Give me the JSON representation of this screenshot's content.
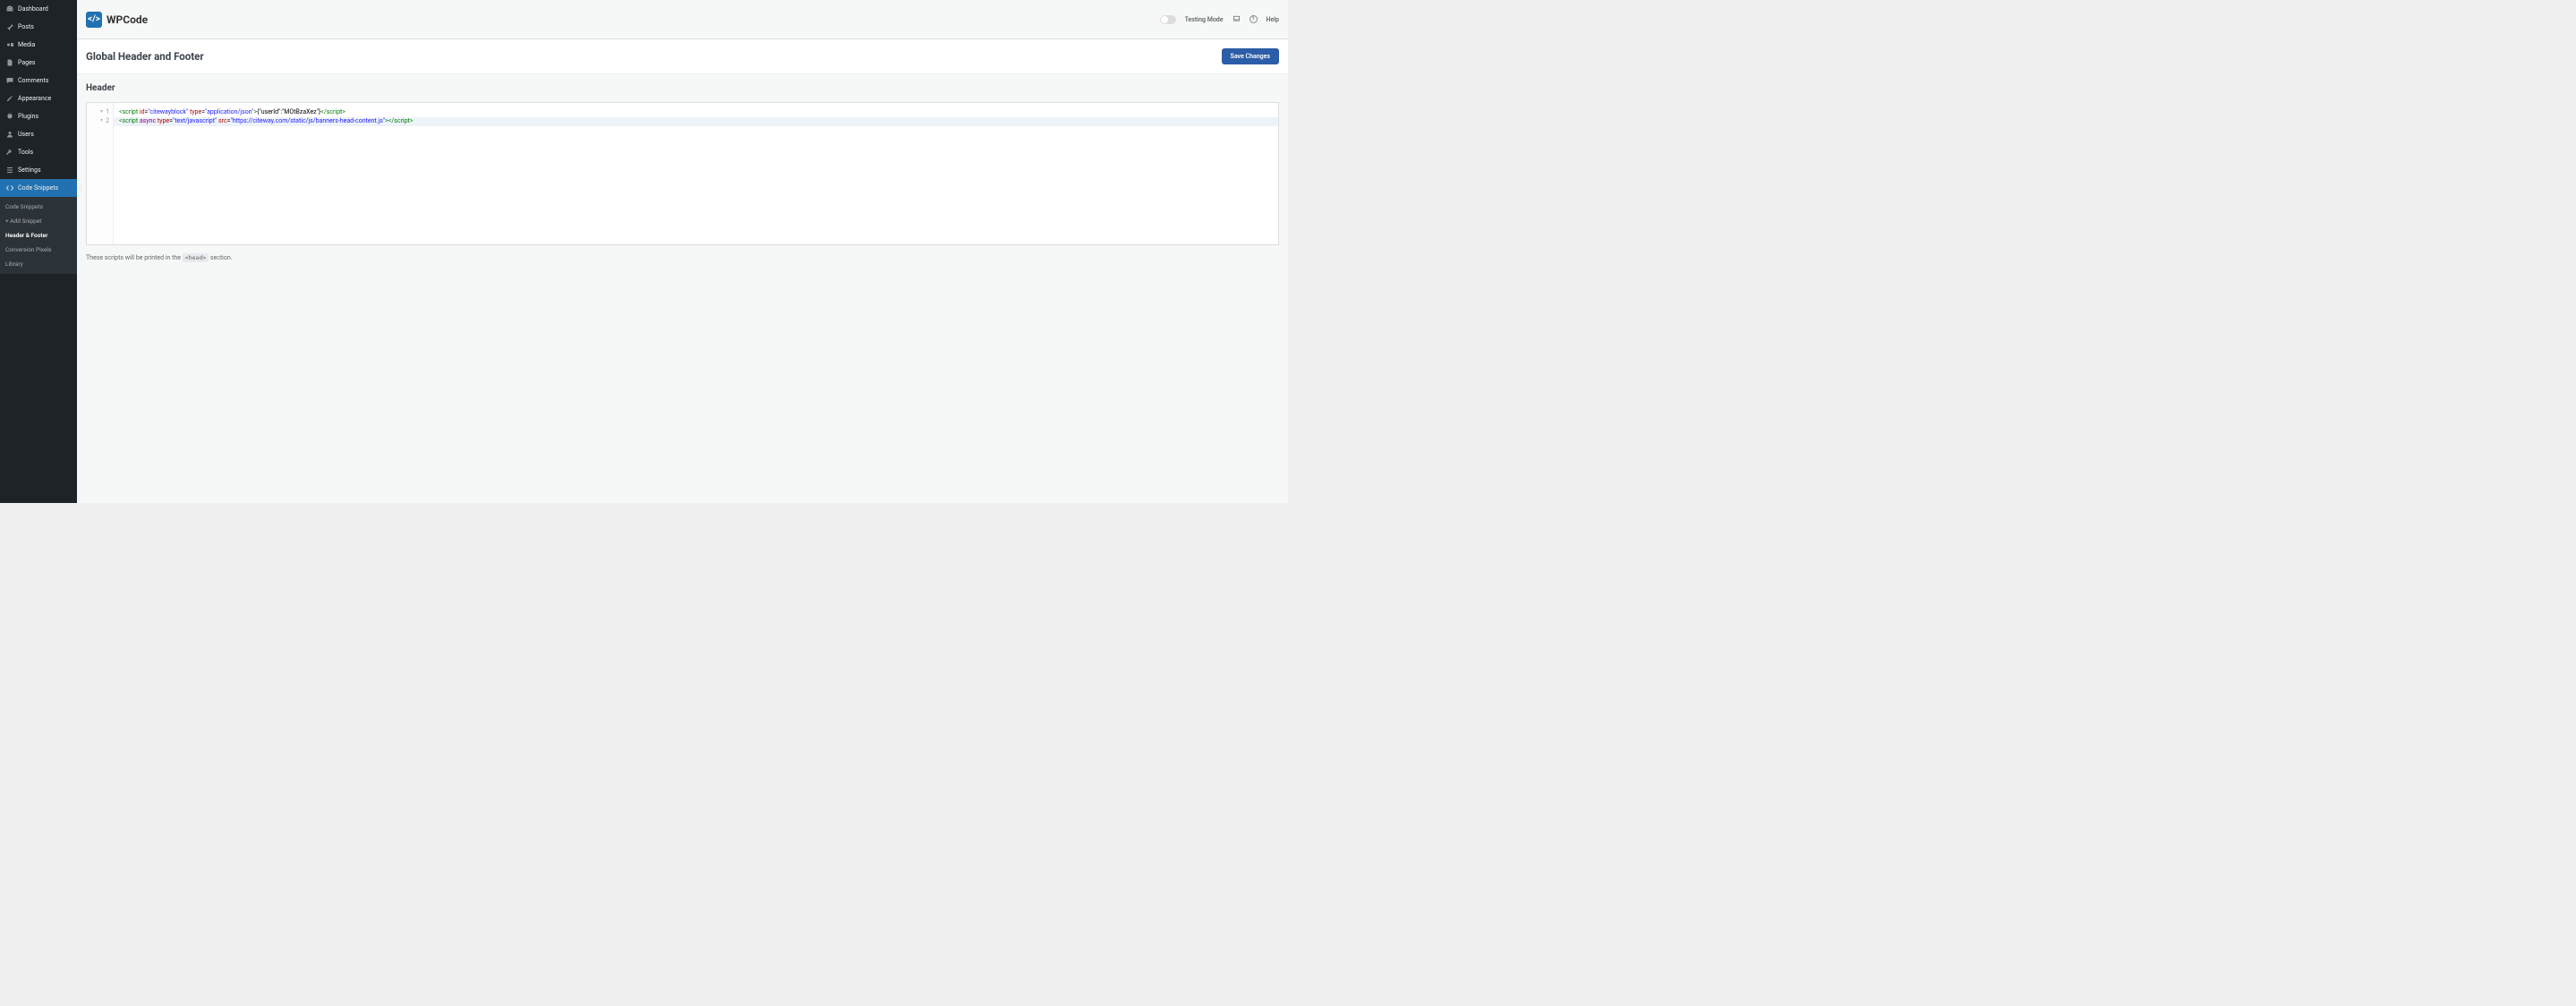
{
  "sidebar": {
    "items": [
      {
        "label": "Dashboard"
      },
      {
        "label": "Posts"
      },
      {
        "label": "Media"
      },
      {
        "label": "Pages"
      },
      {
        "label": "Comments"
      },
      {
        "label": "Appearance"
      },
      {
        "label": "Plugins"
      },
      {
        "label": "Users"
      },
      {
        "label": "Tools"
      },
      {
        "label": "Settings"
      },
      {
        "label": "Code Snippets"
      }
    ],
    "submenu": [
      {
        "label": "Code Snippets"
      },
      {
        "label": "+ Add Snippet"
      },
      {
        "label": "Header & Footer"
      },
      {
        "label": "Conversion Pixels"
      },
      {
        "label": "Library"
      }
    ]
  },
  "logo": {
    "mark": "</>",
    "text": "WPCode"
  },
  "topbar": {
    "testing_mode": "Testing Mode",
    "help": "Help"
  },
  "header": {
    "title": "Global Header and Footer",
    "save": "Save Changes"
  },
  "section": {
    "title": "Header"
  },
  "code": {
    "line1_parts": {
      "open": "<script ",
      "id_attr": "id",
      "id_val": "\"citewayblock\"",
      "type_attr": "type",
      "type_val": "\"application/json\"",
      "inner": "{\"userId\":\"MOtBzaXez\"}",
      "close_tag": "script"
    },
    "line2_parts": {
      "open": "<script ",
      "async_kw": "async",
      "type_attr": "type",
      "type_val": "\"text/javascript\"",
      "src_attr": "src",
      "src_val": "\"https://citeway.com/static/js/banners-head-content.js\"",
      "close_tag": "script"
    }
  },
  "footnote": {
    "prefix": "These scripts will be printed in the ",
    "code": "<head>",
    "suffix": " section."
  }
}
